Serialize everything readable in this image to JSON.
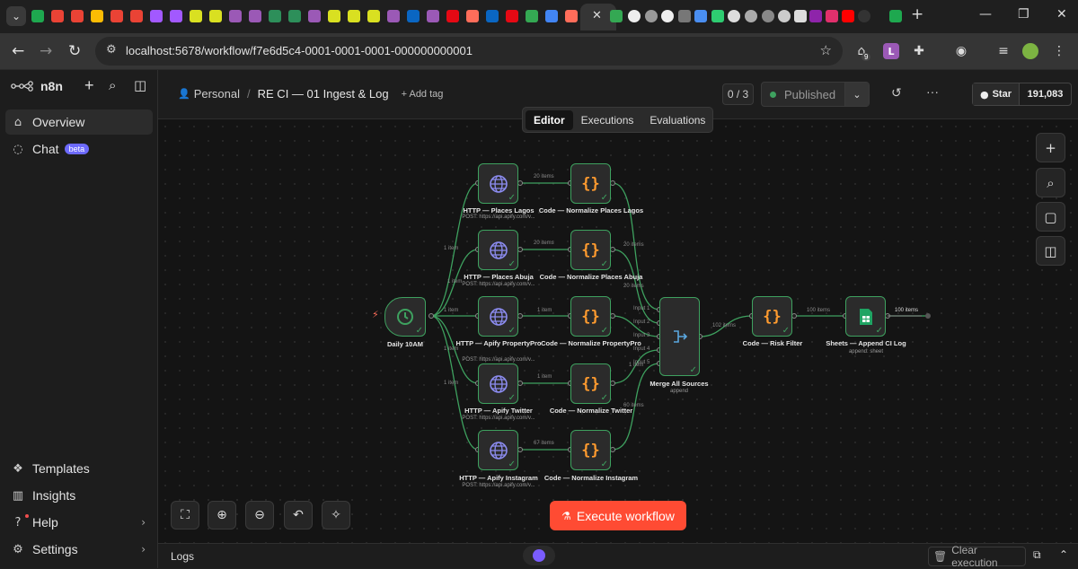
{
  "browser": {
    "url": "localhost:5678/workflow/f7e6d5c4-0001-0001-0001-000000000001",
    "tabs": [
      "n8n-tab-icon",
      "gmail-icon",
      "gmail-icon",
      "meet-icon",
      "gmail-icon",
      "gmail-icon",
      "figma-icon",
      "figma-icon",
      "star-icon",
      "star-icon",
      "s-icon",
      "s-icon",
      "globe-icon",
      "globe-icon",
      "s-icon",
      "star-icon",
      "star-icon",
      "star-icon",
      "s-icon",
      "linkedin-icon",
      "s-icon",
      "netflix-icon",
      "n8n-icon",
      "linkedin-icon",
      "netflix-icon",
      "drive-icon",
      "docs-icon",
      "n8n-icon"
    ],
    "profile_initial": "L",
    "notification_count": "9",
    "new_tab": "+"
  },
  "sidebar": {
    "brand": "n8n",
    "items": [
      {
        "label": "Overview",
        "icon": "home-icon"
      },
      {
        "label": "Chat",
        "icon": "chat-icon",
        "badge": "beta"
      }
    ],
    "bottom": [
      {
        "label": "Templates",
        "icon": "templates-icon"
      },
      {
        "label": "Insights",
        "icon": "insights-icon"
      },
      {
        "label": "Help",
        "icon": "help-icon"
      },
      {
        "label": "Settings",
        "icon": "settings-icon"
      }
    ]
  },
  "header": {
    "project": "Personal",
    "separator": "/",
    "workflow_name": "RE CI — 01 Ingest & Log",
    "add_tag": "+ Add tag",
    "counter": "0 / 3",
    "status": "Published",
    "github_label": "Star",
    "github_stars": "191,083",
    "tabs": [
      "Editor",
      "Executions",
      "Evaluations"
    ]
  },
  "nodes": {
    "trigger": {
      "title": "Daily 10AM"
    },
    "http_lagos": {
      "title": "HTTP — Places Lagos",
      "sub": "POST: https://api.apify.com/v..."
    },
    "http_abuja": {
      "title": "HTTP — Places Abuja",
      "sub": "POST: https://api.apify.com/v..."
    },
    "http_pp": {
      "title": "HTTP — Apify PropertyPro",
      "sub": "POST: https://api.apify.com/v..."
    },
    "http_tw": {
      "title": "HTTP — Apify Twitter",
      "sub": "POST: https://api.apify.com/v..."
    },
    "http_ig": {
      "title": "HTTP — Apify Instagram",
      "sub": "POST: https://api.apify.com/v..."
    },
    "code_lagos": {
      "title": "Code — Normalize Places Lagos"
    },
    "code_abuja": {
      "title": "Code — Normalize Places Abuja"
    },
    "code_pp": {
      "title": "Code — Normalize PropertyPro"
    },
    "code_tw": {
      "title": "Code — Normalize Twitter"
    },
    "code_ig": {
      "title": "Code — Normalize Instagram"
    },
    "merge": {
      "title": "Merge All Sources",
      "sub": "append",
      "inputs": [
        "Input 1",
        "Input 2",
        "Input 3",
        "Input 4",
        "Input 5"
      ]
    },
    "risk": {
      "title": "Code — Risk Filter"
    },
    "sheets": {
      "title": "Sheets — Append CI Log",
      "sub": "append: sheet"
    }
  },
  "edges": {
    "t1": "1 item",
    "t2": "1 item",
    "t3": "1 item",
    "t4": "1 item",
    "t5": "1 item",
    "c1": "20 items",
    "c2": "20 items",
    "c3": "1 item",
    "c4": "1 item",
    "c5": "67 items",
    "m1": "20 items",
    "m2": "20 items",
    "m4": "1 item",
    "m5": "60 items",
    "merge_out": "102 items",
    "risk_out": "100 items",
    "sheets_out": "100 items"
  },
  "canvas": {
    "execute_label": "Execute workflow"
  },
  "logs": {
    "label": "Logs",
    "clear_label": "Clear execution"
  }
}
